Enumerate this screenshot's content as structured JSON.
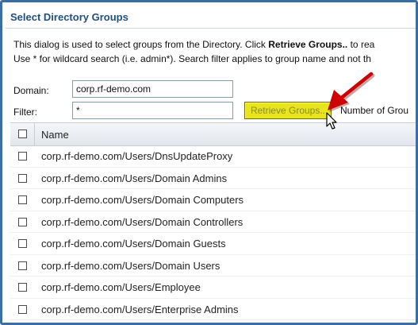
{
  "dialog": {
    "title": "Select Directory Groups",
    "description_line1_prefix": "This dialog is used to select groups from the Directory. Click ",
    "description_line1_bold": "Retrieve Groups..",
    "description_line1_suffix": " to rea",
    "description_line2": "Use * for wildcard search (i.e. admin*). Search filter applies to group name and not th"
  },
  "form": {
    "domain_label": "Domain:",
    "domain_value": "corp.rf-demo.com",
    "filter_label": "Filter:",
    "filter_value": "*",
    "retrieve_button_label": "Retrieve Groups..",
    "number_of_groups_label": "Number of Grou"
  },
  "grid": {
    "column_name": "Name",
    "rows": [
      "corp.rf-demo.com/Users/DnsUpdateProxy",
      "corp.rf-demo.com/Users/Domain Admins",
      "corp.rf-demo.com/Users/Domain Computers",
      "corp.rf-demo.com/Users/Domain Controllers",
      "corp.rf-demo.com/Users/Domain Guests",
      "corp.rf-demo.com/Users/Domain Users",
      "corp.rf-demo.com/Users/Employee",
      "corp.rf-demo.com/Users/Enterprise Admins"
    ]
  },
  "colors": {
    "border": "#3c6ea6",
    "title": "#1f4f7f",
    "button_fill": "#e8e51c",
    "annotation_arrow": "#cc0000"
  },
  "icons": {
    "cursor": "mouse-pointer-icon",
    "annotation": "red-arrow-icon"
  }
}
